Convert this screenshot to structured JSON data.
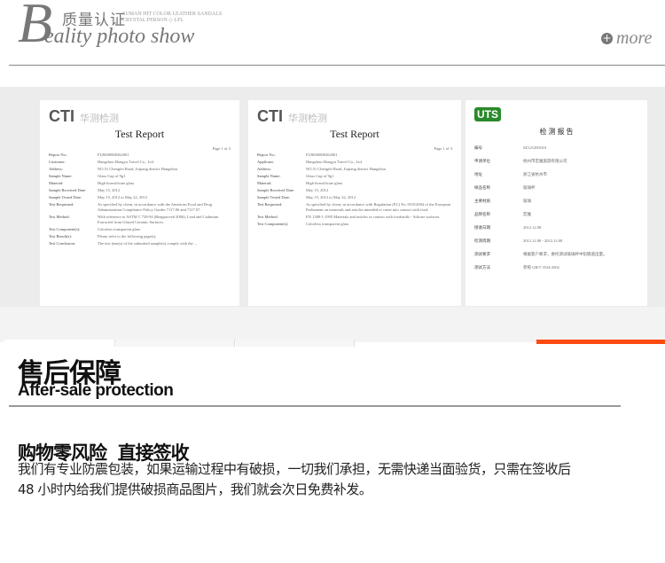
{
  "header": {
    "logo_letter": "B",
    "title_cn": "质量认证",
    "small_en_line1": "SUMAN HIT COLOR LEATHER SANDALS",
    "small_en_line2": "CRYSTAL PERSON ◇ LFL",
    "subtitle": "eality photo show",
    "more_label": "more",
    "more_icon": "plus-circle-icon"
  },
  "certificates": [
    {
      "logo": "CTI",
      "logo_cn": "华测检测",
      "title": "Test Report",
      "page": "Page 1 of 3",
      "fields": [
        {
          "k": "Report No.:",
          "v": "FLR0S0800262001"
        },
        {
          "k": "Customer:",
          "v": "Hangzhou Hongyu Travel Co., Ltd."
        },
        {
          "k": "Address:",
          "v": "NO.51 Chengfei Road, Jiujiang district Hangzhou"
        },
        {
          "k": "Sample Name:",
          "v": "Glass Cup of 9g1"
        },
        {
          "k": "Material:",
          "v": "High borosilicate glass"
        },
        {
          "k": "Sample Received Date:",
          "v": "May 15, 2012"
        },
        {
          "k": "Sample Tested Date:",
          "v": "May 15, 2012 to May 22, 2012"
        },
        {
          "k": "Test Requested:",
          "v": "As specified by client, in accordance with the American Food and Drug Administration Compliance Policy Guides 7117.06 and 7117.07."
        },
        {
          "k": "Test Method:",
          "v": "With reference to ASTM C 738-94 (Reapproved 2006), Lead and Cadmium Extracted from Glazed Ceramic Surfaces."
        },
        {
          "k": "Test Component(s):",
          "v": "Colorless transparent glass"
        },
        {
          "k": "Test Result(s):",
          "v": "Please refer to the following page(s)."
        },
        {
          "k": "Test Conclusion:",
          "v": "The test item(s) of the submitted sample(s) comply with the ..."
        }
      ]
    },
    {
      "logo": "CTI",
      "logo_cn": "华测检测",
      "title": "Test Report",
      "page": "Page 1 of 3",
      "fields": [
        {
          "k": "Report No.:",
          "v": "FLR0S0800262001"
        },
        {
          "k": "Applicant:",
          "v": "Hangzhou Hongyu Travel Co., Ltd."
        },
        {
          "k": "Address:",
          "v": "NO.51 Chengfei Road, Jiujiang district Hangzhou"
        },
        {
          "k": "Sample Name:",
          "v": "Glass Cup of 9g1"
        },
        {
          "k": "Material:",
          "v": "High borosilicate glass"
        },
        {
          "k": "Sample Received Date:",
          "v": "May 15, 2012"
        },
        {
          "k": "Sample Tested Date:",
          "v": "May 15, 2012 to May 22, 2012"
        },
        {
          "k": "Test Requested:",
          "v": "As specified by client, in accordance with Regulation (EC) No 1935/2004 of the European Parliament on materials and articles intended to come into contact with food."
        },
        {
          "k": "Test Method:",
          "v": "EN 1388-1:1995 Materials and articles in contact with foodstuffs - Silicate surfaces."
        },
        {
          "k": "Test Component(s):",
          "v": "Colorless transparent glass"
        }
      ]
    },
    {
      "logo": "UTS",
      "title": "检 测 报 告",
      "fields": [
        {
          "k": "编号",
          "v": "SZ12120010A"
        },
        {
          "k": "申请单位",
          "v": "杭州市宏雅旅游有限公司"
        },
        {
          "k": "地址",
          "v": "浙江省杭州市"
        },
        {
          "k": "样品名称",
          "v": "玻璃杯"
        },
        {
          "k": "主要材质",
          "v": "玻璃"
        },
        {
          "k": "品牌名称",
          "v": "宏雅"
        },
        {
          "k": "接收日期",
          "v": "2012.12.08"
        },
        {
          "k": "检测周期",
          "v": "2012.12.08 - 2012.12.08"
        },
        {
          "k": "测试要求",
          "v": "根据客户要求，委托测试玻璃杯中铅镉溶出量。"
        },
        {
          "k": "测试方法",
          "v": "参照 GB/T 3534-2002"
        }
      ]
    }
  ],
  "after_sale": {
    "title_cn": "售后保障",
    "title_en": "After-sale protection",
    "heading": "购物零风险  直接签收",
    "line1": "我们有专业防震包装，如果运输过程中有破损，一切我们承担，无需快递当面验货，只需在签收后",
    "line2": "48 小时内给我们提供破损商品图片，我们就会次日免费补发。"
  },
  "colors": {
    "accent": "#ff4a12",
    "uts_green": "#2a8a2a"
  }
}
